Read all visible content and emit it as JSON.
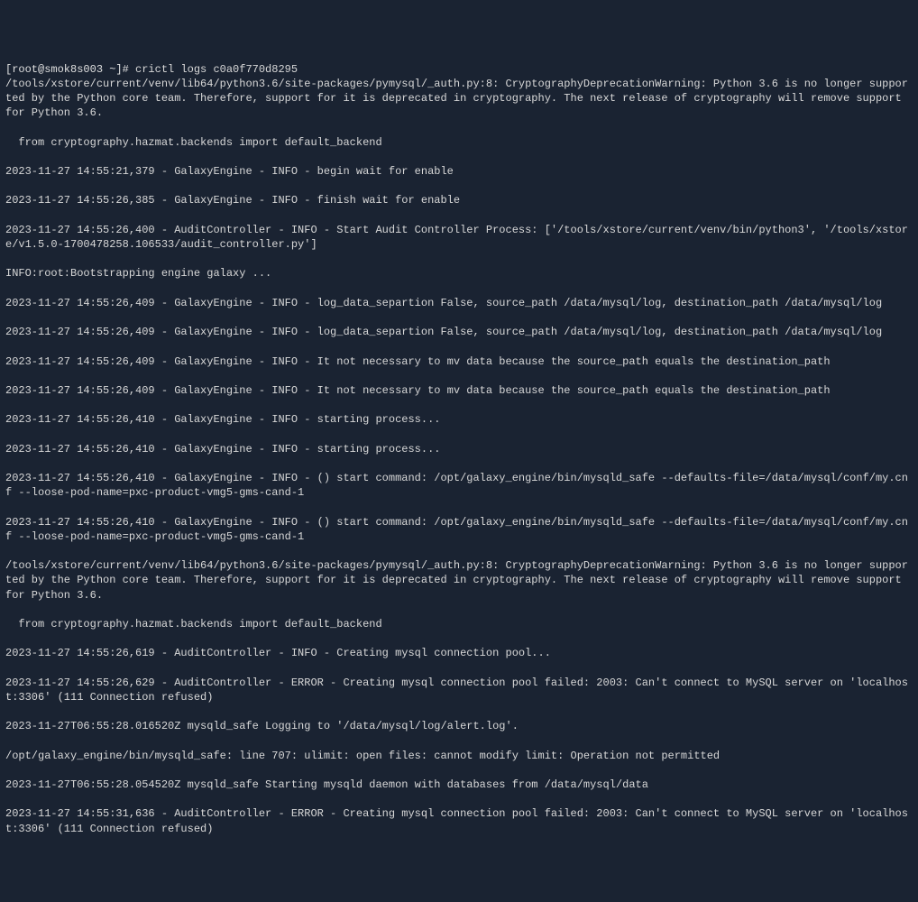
{
  "prompt": {
    "user_host": "[root@smok8s003 ~]#",
    "command": "crictl logs c0a0f770d8295"
  },
  "lines": [
    "/tools/xstore/current/venv/lib64/python3.6/site-packages/pymysql/_auth.py:8: CryptographyDeprecationWarning: Python 3.6 is no longer supported by the Python core team. Therefore, support for it is deprecated in cryptography. The next release of cryptography will remove support for Python 3.6.",
    "  from cryptography.hazmat.backends import default_backend",
    "2023-11-27 14:55:21,379 - GalaxyEngine - INFO - begin wait for enable",
    "2023-11-27 14:55:26,385 - GalaxyEngine - INFO - finish wait for enable",
    "2023-11-27 14:55:26,400 - AuditController - INFO - Start Audit Controller Process: ['/tools/xstore/current/venv/bin/python3', '/tools/xstore/v1.5.0-1700478258.106533/audit_controller.py']",
    "INFO:root:Bootstrapping engine galaxy ...",
    "2023-11-27 14:55:26,409 - GalaxyEngine - INFO - log_data_separtion False, source_path /data/mysql/log, destination_path /data/mysql/log",
    "2023-11-27 14:55:26,409 - GalaxyEngine - INFO - log_data_separtion False, source_path /data/mysql/log, destination_path /data/mysql/log",
    "2023-11-27 14:55:26,409 - GalaxyEngine - INFO - It not necessary to mv data because the source_path equals the destination_path",
    "2023-11-27 14:55:26,409 - GalaxyEngine - INFO - It not necessary to mv data because the source_path equals the destination_path",
    "2023-11-27 14:55:26,410 - GalaxyEngine - INFO - starting process...",
    "2023-11-27 14:55:26,410 - GalaxyEngine - INFO - starting process...",
    "2023-11-27 14:55:26,410 - GalaxyEngine - INFO - () start command: /opt/galaxy_engine/bin/mysqld_safe --defaults-file=/data/mysql/conf/my.cnf --loose-pod-name=pxc-product-vmg5-gms-cand-1",
    "2023-11-27 14:55:26,410 - GalaxyEngine - INFO - () start command: /opt/galaxy_engine/bin/mysqld_safe --defaults-file=/data/mysql/conf/my.cnf --loose-pod-name=pxc-product-vmg5-gms-cand-1",
    "/tools/xstore/current/venv/lib64/python3.6/site-packages/pymysql/_auth.py:8: CryptographyDeprecationWarning: Python 3.6 is no longer supported by the Python core team. Therefore, support for it is deprecated in cryptography. The next release of cryptography will remove support for Python 3.6.",
    "  from cryptography.hazmat.backends import default_backend",
    "2023-11-27 14:55:26,619 - AuditController - INFO - Creating mysql connection pool...",
    "2023-11-27 14:55:26,629 - AuditController - ERROR - Creating mysql connection pool failed: 2003: Can't connect to MySQL server on 'localhost:3306' (111 Connection refused)",
    "2023-11-27T06:55:28.016520Z mysqld_safe Logging to '/data/mysql/log/alert.log'.",
    "/opt/galaxy_engine/bin/mysqld_safe: line 707: ulimit: open files: cannot modify limit: Operation not permitted",
    "2023-11-27T06:55:28.054520Z mysqld_safe Starting mysqld daemon with databases from /data/mysql/data",
    "2023-11-27 14:55:31,636 - AuditController - ERROR - Creating mysql connection pool failed: 2003: Can't connect to MySQL server on 'localhost:3306' (111 Connection refused)"
  ]
}
